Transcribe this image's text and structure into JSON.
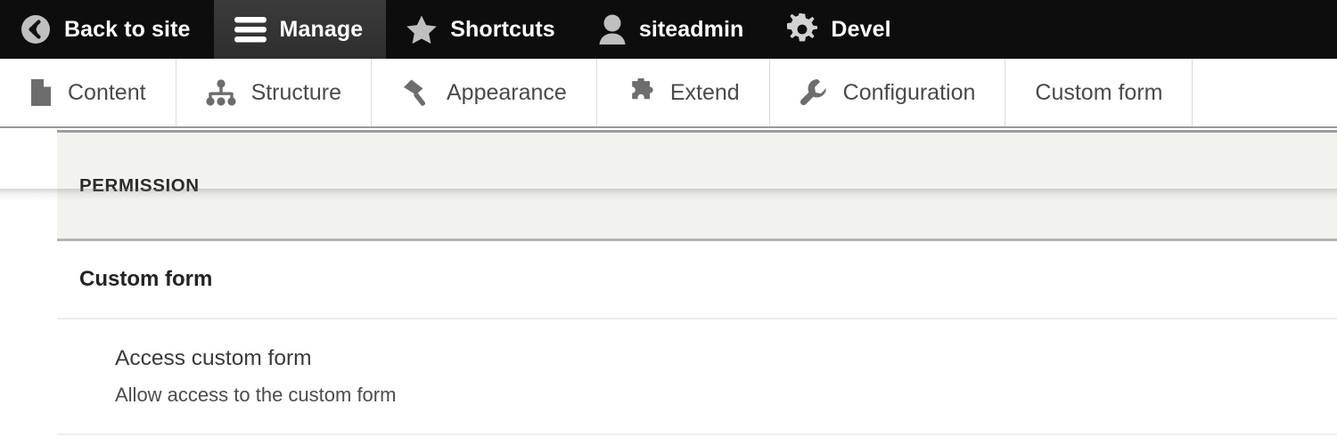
{
  "toolbar": {
    "items": [
      {
        "label": "Back to site",
        "icon": "back-arrow-circle-icon",
        "active": false
      },
      {
        "label": "Manage",
        "icon": "hamburger-menu-icon",
        "active": true
      },
      {
        "label": "Shortcuts",
        "icon": "star-icon",
        "active": false
      },
      {
        "label": "siteadmin",
        "icon": "user-person-icon",
        "active": false
      },
      {
        "label": "Devel",
        "icon": "gear-icon",
        "active": false
      }
    ]
  },
  "menu_bar": {
    "items": [
      {
        "label": "Content",
        "icon": "file-document-icon"
      },
      {
        "label": "Structure",
        "icon": "site-structure-tree-icon"
      },
      {
        "label": "Appearance",
        "icon": "paint-brush-icon"
      },
      {
        "label": "Extend",
        "icon": "puzzle-piece-icon"
      },
      {
        "label": "Configuration",
        "icon": "wrench-icon"
      },
      {
        "label": "Custom form",
        "icon": "none"
      }
    ]
  },
  "permissions_table": {
    "headers": [
      "PERMISSION"
    ],
    "groups": [
      {
        "module": "Custom form",
        "permissions": [
          {
            "title": "Access custom form",
            "description": "Allow access to the custom form"
          }
        ]
      }
    ]
  },
  "colors": {
    "toolbar_bg": "#0d0d0d",
    "toolbar_active_bg": "#333333",
    "menu_bg": "#ffffff",
    "menu_text": "#4a4a4a",
    "table_header_bg": "#f2f2ee",
    "table_border": "#ededea",
    "page_bg": "#ffffff"
  }
}
